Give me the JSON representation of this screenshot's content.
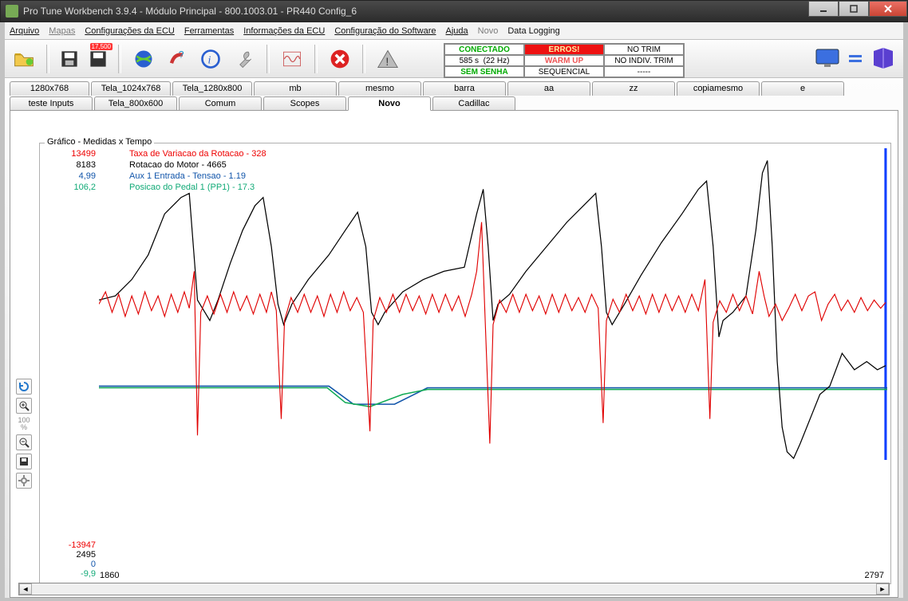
{
  "window": {
    "title": "Pro Tune Workbench 3.9.4 - Módulo Principal -  800.1003.01 - PR440    Config_6"
  },
  "menu": {
    "arquivo": "Arquivo",
    "mapas": "Mapas",
    "config_ecu": "Configurações da ECU",
    "ferramentas": "Ferramentas",
    "info_ecu": "Informações da ECU",
    "config_soft": "Configuração do Software",
    "ajuda": "Ajuda",
    "novo": "Novo",
    "datalog": "Data Logging"
  },
  "status": {
    "r1c1": "CONECTADO",
    "r1c2": "ERROS!",
    "r1c3": "NO TRIM",
    "r2c1": "585 s",
    "r2c1b": "(22 Hz)",
    "r2c2": "WARM UP",
    "r2c3": "NO INDIV. TRIM",
    "r3c1": "SEM SENHA",
    "r3c2": "SEQUENCIAL",
    "r3c3": "-----"
  },
  "tabs_row1": [
    "1280x768",
    "Tela_1024x768",
    "Tela_1280x800",
    "mb",
    "mesmo",
    "barra",
    "aa",
    "zz",
    "copiamesmo",
    "e"
  ],
  "tabs_row2": [
    "teste Inputs",
    "Tela_800x600",
    "Comum",
    "Scopes",
    "Novo",
    "Cadillac"
  ],
  "active_tab": "Novo",
  "chart": {
    "box_title": "Gráfico - Medidas x Tempo",
    "legend": {
      "s1": "Taxa de Variacao da Rotacao -  328",
      "s2": "Rotacao do Motor -  4665",
      "s3": "Aux 1 Entrada - Tensao -  1.19",
      "s4": "Posicao do Pedal 1 (PP1) -  17.3"
    },
    "y_top": {
      "s1": "13499",
      "s2": "8183",
      "s3": "4,99",
      "s4": "106,2"
    },
    "y_bot": {
      "s1": "-13947",
      "s2": "2495",
      "s3": "0",
      "s4": "-9,9"
    },
    "x_min": "1860",
    "x_max": "2797"
  },
  "side": {
    "zoom_pct": "100",
    "zoom_unit": "%"
  },
  "chart_data": {
    "type": "line",
    "x_range": [
      1860,
      2797
    ],
    "series": [
      {
        "name": "Taxa de Variacao da Rotacao",
        "color": "#e00000",
        "y_range": [
          -13947,
          13499
        ],
        "current": 328
      },
      {
        "name": "Rotacao do Motor",
        "color": "#000000",
        "y_range": [
          2495,
          8183
        ],
        "current": 4665
      },
      {
        "name": "Aux 1 Entrada - Tensao",
        "color": "#1155aa",
        "y_range": [
          0,
          4.99
        ],
        "current": 1.19
      },
      {
        "name": "Posicao do Pedal 1 (PP1)",
        "color": "#11aa77",
        "y_range": [
          -9.9,
          106.2
        ],
        "current": 17.3
      }
    ],
    "note": "waveform values approximated from pixels; cursor at x_max"
  }
}
